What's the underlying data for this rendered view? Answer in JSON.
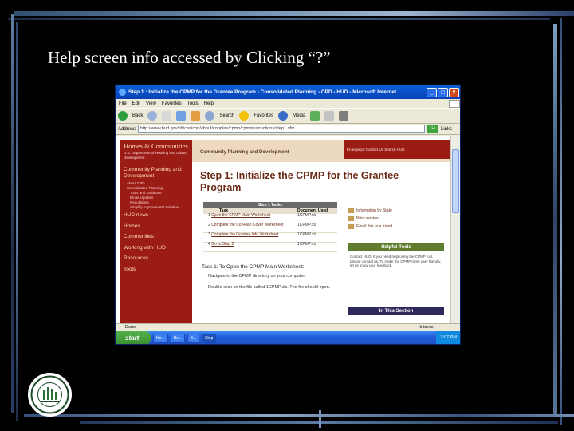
{
  "slide": {
    "title": "Help screen info accessed by Clicking “?”"
  },
  "window": {
    "title": "Step 1 : Initialize the CPMP for the Grantee Program - Consolidated Planning - CPD - HUD - Microsoft Internet ...",
    "minimize": "_",
    "maximize": "□",
    "close": "×"
  },
  "menu": [
    "File",
    "Edit",
    "View",
    "Favorites",
    "Tools",
    "Help"
  ],
  "toolbar": {
    "back": "Back",
    "search": "Search",
    "favorites": "Favorites",
    "media": "Media"
  },
  "address": {
    "label": "Address",
    "value": "http://www.hud.gov/offices/cpd/about/conplan/cpmp/cpmpinstructions/step1.cfm",
    "go": "Go",
    "links": "Links"
  },
  "hud_nav": {
    "logo": "Homes & Communities",
    "logo_sub": "U.S. Department of Housing and Urban Development",
    "section": "Community Planning and Development",
    "items": [
      "About CPD",
      "Consolidated Planning"
    ],
    "subitems": [
      "Tools and Guidance",
      "Email Updates",
      "Regulations",
      "Simplify Improvement Initiative"
    ],
    "links": [
      "HUD news",
      "Homes",
      "Communities",
      "Working with HUD",
      "Resources",
      "Tools"
    ]
  },
  "hud_header": {
    "cpd": "Community Planning and Development",
    "toplinks": "En espaņol   Contact Us   Search HUD"
  },
  "page": {
    "h1": "Step 1: Initialize the CPMP for the Grantee Program",
    "table_title": "Step 1 Tasks",
    "col_task": "Task",
    "col_doc": "Document Used",
    "rows": [
      {
        "num": "1",
        "task": "Open the CPMP Main Worksheet",
        "doc": "1CPMP.xls"
      },
      {
        "num": "2",
        "task": "Complete the ConPlan Cover Worksheet",
        "doc": "1CPMP.xls"
      },
      {
        "num": "3",
        "task": "Complete the Grantee Info Worksheet",
        "doc": "1CPMP.xls"
      },
      {
        "num": "4",
        "task": "Go to Step 2",
        "doc": "1CPMP.xls"
      }
    ],
    "task1_heading": "Task 1: To Open the CPMP Main Worksheet:",
    "task1_items": [
      "Navigate to the CPMP directory on your computer.",
      "Double-click on the file called 1CPMP.xls. The file should open."
    ],
    "side_links": [
      "Information by State",
      "Print version",
      "Email this to a friend"
    ],
    "helpful_tools": "Helpful Tools",
    "helpful_body": "Contact HUD. If you need help using the CPMP tool, please contact us. To make the CPMP more user friendly, let us know your feedback.",
    "in_this_section": "In This Section"
  },
  "status": {
    "left": "Done",
    "right": "Internet"
  },
  "taskbar": {
    "start": "start",
    "buttons": [
      "Ho...",
      "Re...",
      "3...",
      "Step"
    ],
    "clock": "3:07 PM"
  },
  "colors": {
    "slide_bg": "#000000",
    "hud_red": "#9a1c14",
    "xp_blue": "#245edb"
  }
}
